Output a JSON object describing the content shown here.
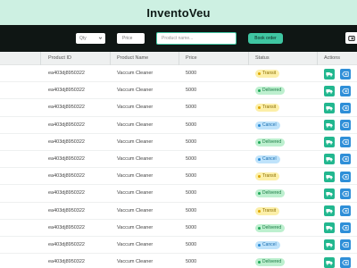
{
  "app": {
    "title": "InventoVeu"
  },
  "toolbar": {
    "qty_value": "Qty",
    "price_placeholder": "Price",
    "product_name_placeholder": "Product name...",
    "book_label": "Book order"
  },
  "table": {
    "headers": {
      "product_id": "Product ID",
      "product_name": "Product Name",
      "price": "Price",
      "status": "Status",
      "actions": "Actions"
    },
    "rows": [
      {
        "product_id": "ea403dj8950322",
        "product_name": "Vaccum Cleaner",
        "price": "5000",
        "status": "Transit",
        "status_type": "transit"
      },
      {
        "product_id": "ea403dj8950322",
        "product_name": "Vaccum Cleaner",
        "price": "5000",
        "status": "Delivered",
        "status_type": "delivered"
      },
      {
        "product_id": "ea403dj8950322",
        "product_name": "Vaccum Cleaner",
        "price": "5000",
        "status": "Transit",
        "status_type": "transit"
      },
      {
        "product_id": "ea403dj8950322",
        "product_name": "Vaccum Cleaner",
        "price": "5000",
        "status": "Cancel",
        "status_type": "cancel"
      },
      {
        "product_id": "ea403dj8950322",
        "product_name": "Vaccum Cleaner",
        "price": "5000",
        "status": "Delivered",
        "status_type": "delivered"
      },
      {
        "product_id": "ea403dj8950322",
        "product_name": "Vaccum Cleaner",
        "price": "5000",
        "status": "Cancel",
        "status_type": "cancel"
      },
      {
        "product_id": "ea403dj8950322",
        "product_name": "Vaccum Cleaner",
        "price": "5000",
        "status": "Transit",
        "status_type": "transit"
      },
      {
        "product_id": "ea403dj8950322",
        "product_name": "Vaccum Cleaner",
        "price": "5000",
        "status": "Delivered",
        "status_type": "delivered"
      },
      {
        "product_id": "ea403dj8950322",
        "product_name": "Vaccum Cleaner",
        "price": "5000",
        "status": "Transit",
        "status_type": "transit"
      },
      {
        "product_id": "ea403dj8950322",
        "product_name": "Vaccum Cleaner",
        "price": "5000",
        "status": "Delivered",
        "status_type": "delivered"
      },
      {
        "product_id": "ea403dj8950322",
        "product_name": "Vaccum Cleaner",
        "price": "5000",
        "status": "Cancel",
        "status_type": "cancel"
      },
      {
        "product_id": "ea403dj8950322",
        "product_name": "Vaccum Cleaner",
        "price": "5000",
        "status": "Delivered",
        "status_type": "delivered"
      }
    ],
    "action_icons": [
      "truck-icon",
      "delete-icon"
    ]
  },
  "colors": {
    "accent": "#3fc6a2",
    "header_bg": "#cdf0e2",
    "toolbar_bg": "#0f1614",
    "transit": "#fcefa8",
    "delivered": "#bdf0cf",
    "cancel": "#bfe3fb",
    "truck_button": "#22b78f",
    "delete_button": "#2f8fd8"
  }
}
